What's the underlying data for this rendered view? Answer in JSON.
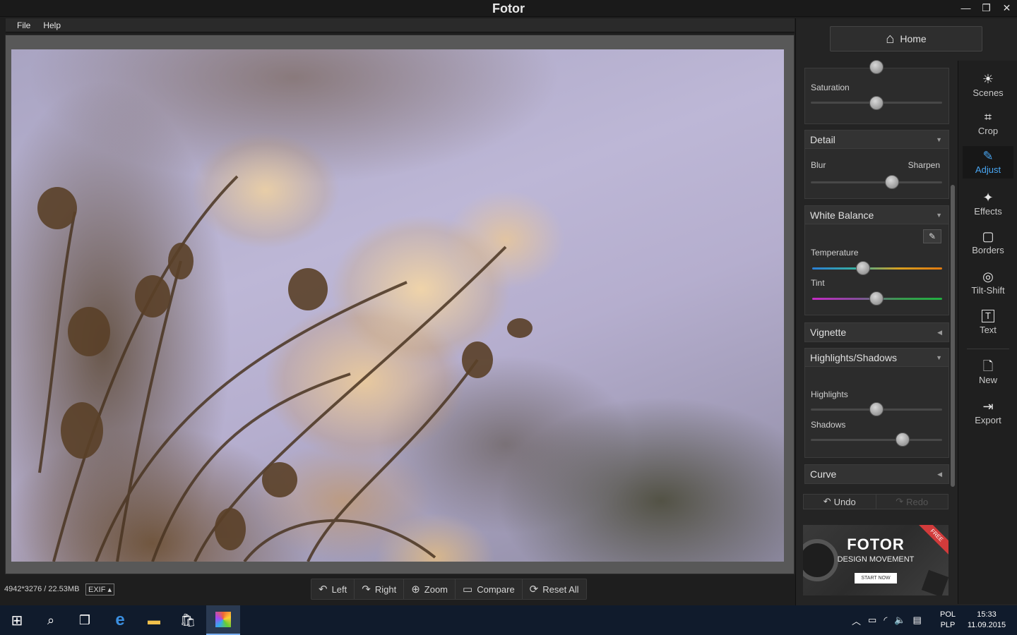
{
  "app": {
    "title": "Fotor"
  },
  "window_controls": {
    "minimize": "—",
    "maximize": "❐",
    "close": "✕"
  },
  "menu": {
    "file": "File",
    "help": "Help"
  },
  "status": {
    "image_info": "4942*3276 / 22.53MB",
    "exif_label": "EXIF ▴"
  },
  "bottom_toolbar": {
    "left": "Left",
    "right": "Right",
    "zoom": "Zoom",
    "compare": "Compare",
    "reset_all": "Reset All"
  },
  "panel": {
    "home": "Home",
    "saturation": {
      "label": "Saturation",
      "value": 0.5
    },
    "detail": {
      "header": "Detail",
      "blur": "Blur",
      "sharpen": "Sharpen",
      "value": 0.62
    },
    "white_balance": {
      "header": "White Balance",
      "temperature": {
        "label": "Temperature",
        "value": 0.4
      },
      "tint": {
        "label": "Tint",
        "value": 0.5
      }
    },
    "vignette": {
      "header": "Vignette"
    },
    "highlights_shadows": {
      "header": "Highlights/Shadows",
      "highlights": {
        "label": "Highlights",
        "value": 0.5
      },
      "shadows": {
        "label": "Shadows",
        "value": 0.7
      }
    },
    "curve": {
      "header": "Curve"
    },
    "undo": "Undo",
    "redo": "Redo"
  },
  "ad": {
    "title": "FOTOR",
    "subtitle": "DESIGN MOVEMENT",
    "cta": "START NOW",
    "badge": "FREE"
  },
  "tools": {
    "scenes": "Scenes",
    "crop": "Crop",
    "adjust": "Adjust",
    "effects": "Effects",
    "borders": "Borders",
    "tilt_shift": "Tilt-Shift",
    "text": "Text",
    "new": "New",
    "export": "Export"
  },
  "taskbar": {
    "lang_top": "POL",
    "lang_bottom": "PLP",
    "time": "15:33",
    "date": "11.09.2015"
  },
  "colors": {
    "accent": "#49a6f2",
    "panel_bg": "#242424",
    "taskbar_bg": "#101b2c"
  }
}
